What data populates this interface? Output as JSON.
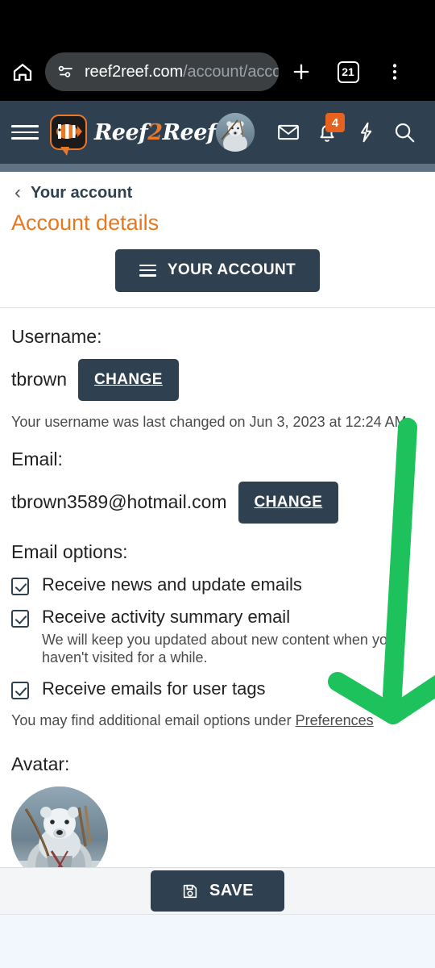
{
  "browser": {
    "home_icon": "home-icon",
    "site_info_icon": "page-info-icon",
    "url_domain": "reef2reef.com",
    "url_path": "/account/acco",
    "new_tab_icon": "plus-icon",
    "tab_count": "21",
    "menu_icon": "three-dot-menu-icon"
  },
  "site_header": {
    "menu_icon": "hamburger-icon",
    "logo_text_1": "Reef",
    "logo_text_2": "2",
    "logo_text_3": "Reef",
    "avatar_icon": "user-avatar",
    "mail_icon": "envelope-icon",
    "bell_icon": "bell-icon",
    "bell_badge": "4",
    "bolt_icon": "lightning-bolt-icon",
    "search_icon": "search-icon",
    "brand_color": "#2f4050",
    "accent_color": "#e8781f"
  },
  "breadcrumb": {
    "back_icon": "chevron-left-icon",
    "label": "Your account"
  },
  "page": {
    "title": "Account details",
    "account_button": {
      "label": "YOUR ACCOUNT",
      "icon": "hamburger-icon"
    },
    "username": {
      "label": "Username:",
      "value": "tbrown",
      "change_label": "CHANGE",
      "help": "Your username was last changed on Jun 3, 2023 at 12:24 AM."
    },
    "email": {
      "label": "Email:",
      "value": "tbrown3589@hotmail.com",
      "change_label": "CHANGE"
    },
    "email_options": {
      "label": "Email options:",
      "items": [
        {
          "label": "Receive news and update emails",
          "checked": true,
          "sub": ""
        },
        {
          "label": "Receive activity summary email",
          "checked": true,
          "sub": "We will keep you updated about new content when you haven't visited for a while."
        },
        {
          "label": "Receive emails for user tags",
          "checked": true,
          "sub": ""
        }
      ],
      "note_prefix": "You may find additional email options under ",
      "note_link": "Preferences",
      "note_suffix": "."
    },
    "avatar": {
      "label": "Avatar:",
      "image_name": "polar-bear-warrior-avatar"
    }
  },
  "footer": {
    "save_label": "SAVE",
    "save_icon": "floppy-disk-icon"
  },
  "annotation": {
    "arrow_icon": "down-arrow-annotation",
    "color": "#1ec25c"
  }
}
